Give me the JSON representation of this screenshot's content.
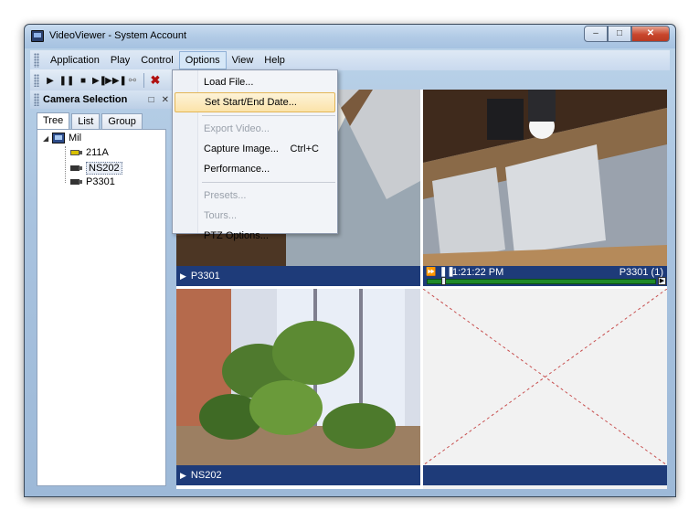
{
  "window": {
    "title": "VideoViewer - System Account",
    "minimize": "–",
    "maximize": "□",
    "close": "✕"
  },
  "menubar": {
    "items": [
      "Application",
      "Play",
      "Control",
      "Options",
      "View",
      "Help"
    ]
  },
  "toolbar": {
    "play": "▶",
    "pause": "❚❚",
    "stop": "■",
    "step": "▶❚",
    "next": "▶▶❚",
    "ptz": "⚯",
    "close": "✖"
  },
  "panel": {
    "title": "Camera Selection",
    "pin": "□",
    "close": "✕"
  },
  "tabs": [
    "Tree",
    "List",
    "Group"
  ],
  "tree": {
    "root": {
      "label": "Mil",
      "icon": "computer-icon"
    },
    "cameras": [
      {
        "label": "211A",
        "icon": "camera-icon"
      },
      {
        "label": "NS202",
        "icon": "camera-icon",
        "selected": true
      },
      {
        "label": "P3301",
        "icon": "camera-icon"
      }
    ]
  },
  "options_menu": {
    "items": [
      {
        "label": "Load File...",
        "enabled": true
      },
      {
        "label": "Set Start/End Date...",
        "enabled": true,
        "highlighted": true
      },
      {
        "label": "Export Video...",
        "enabled": false
      },
      {
        "label": "Capture Image...",
        "shortcut": "Ctrl+C",
        "enabled": true
      },
      {
        "label": "Performance...",
        "enabled": true
      },
      {
        "label": "Presets...",
        "enabled": false
      },
      {
        "label": "Tours...",
        "enabled": false
      },
      {
        "label": "PTZ Options...",
        "enabled": true
      }
    ]
  },
  "video_cells": {
    "top_left": {
      "caption": "P3301"
    },
    "top_right": {
      "time": "1:21:22 PM",
      "caption": "P3301 (1)",
      "progress": 0.08
    },
    "bottom_left": {
      "caption": "NS202"
    },
    "bottom_right": {
      "caption": ""
    }
  },
  "colors": {
    "caption_bg": "#1e3b79",
    "progress": "#1f8a2a",
    "menu_highlight": "#fbe3a9"
  }
}
